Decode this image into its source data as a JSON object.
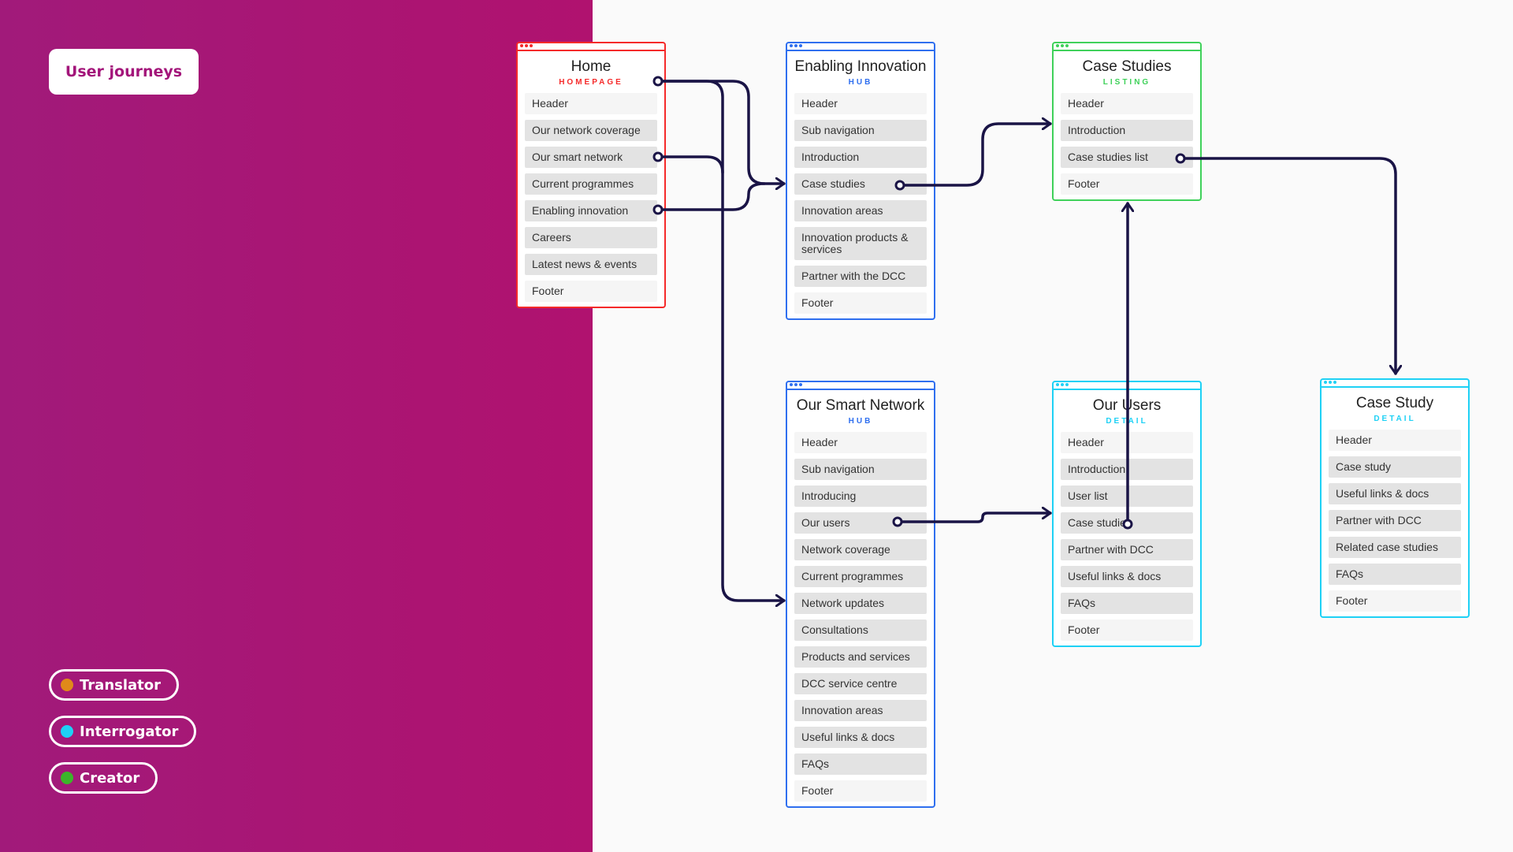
{
  "title": "User journeys",
  "legend": [
    {
      "label": "Translator",
      "color": "#e08a1a"
    },
    {
      "label": "Interrogator",
      "color": "#1ed1f5"
    },
    {
      "label": "Creator",
      "color": "#3cb52a"
    }
  ],
  "colors": {
    "panel": "#a8177a",
    "homepage": "#f52a2a",
    "hub": "#2f6fef",
    "listing": "#3fd15a",
    "detail": "#1ed1f5",
    "link": "#1a1446"
  },
  "cards": {
    "home": {
      "title": "Home",
      "type": "HOMEPAGE",
      "rows": [
        "Header",
        "Our network coverage",
        "Our smart network",
        "Current programmes",
        "Enabling innovation",
        "Careers",
        "Latest news & events",
        "Footer"
      ]
    },
    "enabling": {
      "title": "Enabling Innovation",
      "type": "HUB",
      "rows": [
        "Header",
        "Sub navigation",
        "Introduction",
        "Case studies",
        "Innovation areas",
        "Innovation products & services",
        "Partner with the DCC",
        "Footer"
      ]
    },
    "casestudies": {
      "title": "Case Studies",
      "type": "LISTING",
      "rows": [
        "Header",
        "Introduction",
        "Case studies list",
        "Footer"
      ]
    },
    "smartnetwork": {
      "title": "Our Smart Network",
      "type": "HUB",
      "rows": [
        "Header",
        "Sub navigation",
        "Introducing",
        "Our users",
        "Network coverage",
        "Current programmes",
        "Network updates",
        "Consultations",
        "Products and services",
        "DCC service centre",
        "Innovation areas",
        "Useful links & docs",
        "FAQs",
        "Footer"
      ]
    },
    "ourusers": {
      "title": "Our Users",
      "type": "DETAIL",
      "rows": [
        "Header",
        "Introduction",
        "User list",
        "Case studies",
        "Partner with DCC",
        "Useful links & docs",
        "FAQs",
        "Footer"
      ]
    },
    "casestudy": {
      "title": "Case Study",
      "type": "DETAIL",
      "rows": [
        "Header",
        "Case study",
        "Useful links & docs",
        "Partner with DCC",
        "Related case studies",
        "FAQs",
        "Footer"
      ]
    }
  },
  "links": [
    {
      "from": "Home (page)",
      "to": "Enabling Innovation"
    },
    {
      "from": "Home (page)",
      "to": "Our Smart Network"
    },
    {
      "from": "Home / Our smart network",
      "to": "Our Smart Network"
    },
    {
      "from": "Home / Enabling innovation",
      "to": "Enabling Innovation"
    },
    {
      "from": "Enabling Innovation / Case studies",
      "to": "Case Studies"
    },
    {
      "from": "Case Studies / Case studies list",
      "to": "Case Study"
    },
    {
      "from": "Our Smart Network / Our users",
      "to": "Our Users"
    },
    {
      "from": "Our Users / Case studies",
      "to": "Case Studies"
    }
  ]
}
